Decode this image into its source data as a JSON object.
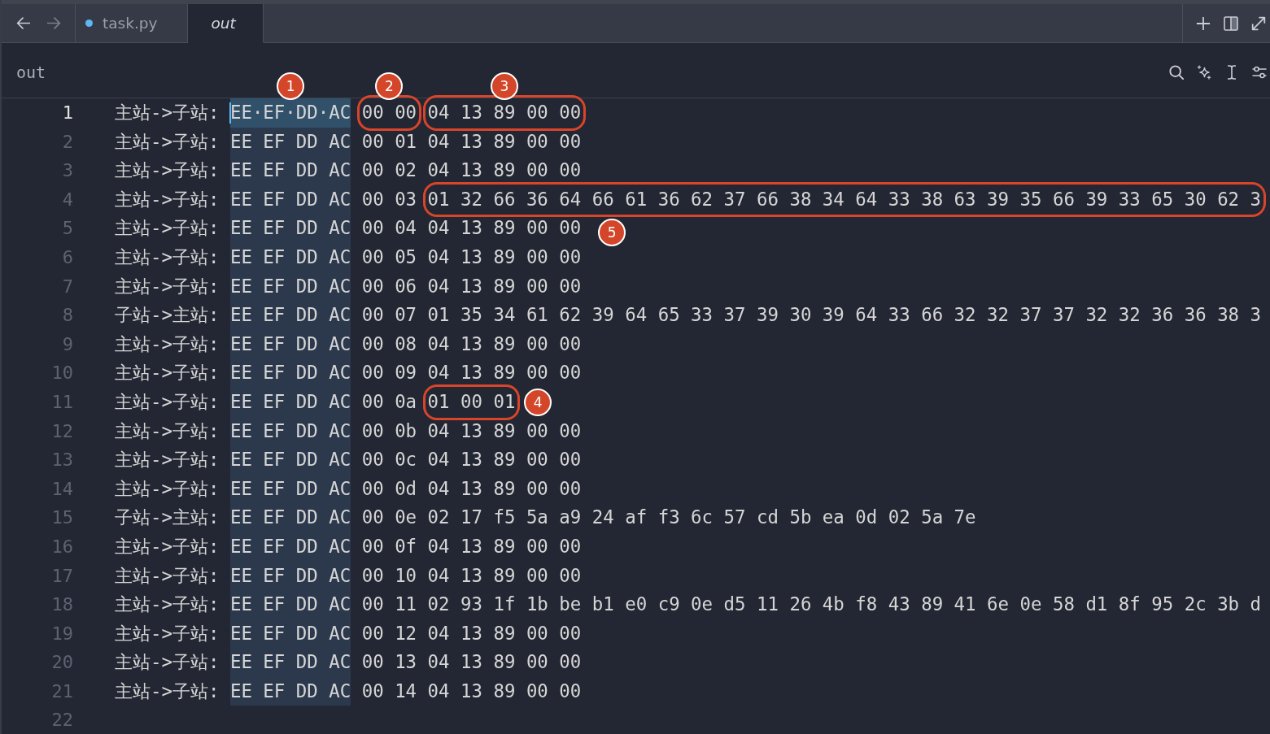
{
  "navigation": [
    {
      "kind": "back",
      "disabled": false
    },
    {
      "kind": "forward",
      "disabled": true
    }
  ],
  "tabs": [
    {
      "label": "task.py",
      "selected": false,
      "modified": true,
      "preview": false
    },
    {
      "label": "out",
      "selected": true,
      "modified": false,
      "preview": true
    }
  ],
  "tab_bar_actions": [
    {
      "kind": "new"
    },
    {
      "kind": "split"
    },
    {
      "kind": "expand"
    }
  ],
  "panel": {
    "title": "out",
    "tools": [
      {
        "kind": "search"
      },
      {
        "kind": "assistant"
      },
      {
        "kind": "cursor"
      },
      {
        "kind": "settings"
      }
    ]
  },
  "editor": {
    "lines": [
      {
        "number": "1",
        "direction": "主站->子站:",
        "header": "EE·EF·DD·AC",
        "sequence": "00 00",
        "payload": "04 13 89 00 00",
        "selected": true,
        "current": true,
        "header_mark": {
          "kind": "above",
          "label": "1",
          "ring": false
        },
        "sequence_mark": {
          "kind": "above",
          "label": "2",
          "ring": true
        },
        "payload_mark": {
          "kind": "above",
          "label": "3",
          "ring": true
        }
      },
      {
        "number": "2",
        "direction": "主站->子站:",
        "header": "EE EF DD AC",
        "sequence": "00 01",
        "payload": "04 13 89 00 00",
        "selected": true,
        "current": false
      },
      {
        "number": "3",
        "direction": "主站->子站:",
        "header": "EE EF DD AC",
        "sequence": "00 02",
        "payload": "04 13 89 00 00",
        "selected": true,
        "current": false
      },
      {
        "number": "4",
        "direction": "主站->子站:",
        "header": "EE EF DD AC",
        "sequence": "00 03",
        "payload": "01 32 66 36 64 66 61 36 62 37 66 38 34 64 33 38 63 39 35 66 39 33 65 30 62 3",
        "selected": true,
        "current": false,
        "payload_mark": {
          "kind": "below",
          "label": "5",
          "ring": true
        }
      },
      {
        "number": "5",
        "direction": "主站->子站:",
        "header": "EE EF DD AC",
        "sequence": "00 04",
        "payload": "04 13 89 00 00",
        "selected": true,
        "current": false
      },
      {
        "number": "6",
        "direction": "主站->子站:",
        "header": "EE EF DD AC",
        "sequence": "00 05",
        "payload": "04 13 89 00 00",
        "selected": true,
        "current": false
      },
      {
        "number": "7",
        "direction": "主站->子站:",
        "header": "EE EF DD AC",
        "sequence": "00 06",
        "payload": "04 13 89 00 00",
        "selected": true,
        "current": false
      },
      {
        "number": "8",
        "direction": "子站->主站:",
        "header": "EE EF DD AC",
        "sequence": "00 07",
        "payload": "01 35 34 61 62 39 64 65 33 37 39 30 39 64 33 66 32 32 37 37 32 32 36 36 38 3",
        "selected": true,
        "current": false
      },
      {
        "number": "9",
        "direction": "主站->子站:",
        "header": "EE EF DD AC",
        "sequence": "00 08",
        "payload": "04 13 89 00 00",
        "selected": true,
        "current": false
      },
      {
        "number": "10",
        "direction": "主站->子站:",
        "header": "EE EF DD AC",
        "sequence": "00 09",
        "payload": "04 13 89 00 00",
        "selected": true,
        "current": false
      },
      {
        "number": "11",
        "direction": "主站->子站:",
        "header": "EE EF DD AC",
        "sequence": "00 0a",
        "payload": "01 00 01",
        "selected": true,
        "current": false,
        "payload_mark": {
          "kind": "right",
          "label": "4",
          "ring": true
        }
      },
      {
        "number": "12",
        "direction": "主站->子站:",
        "header": "EE EF DD AC",
        "sequence": "00 0b",
        "payload": "04 13 89 00 00",
        "selected": true,
        "current": false
      },
      {
        "number": "13",
        "direction": "主站->子站:",
        "header": "EE EF DD AC",
        "sequence": "00 0c",
        "payload": "04 13 89 00 00",
        "selected": true,
        "current": false
      },
      {
        "number": "14",
        "direction": "主站->子站:",
        "header": "EE EF DD AC",
        "sequence": "00 0d",
        "payload": "04 13 89 00 00",
        "selected": true,
        "current": false
      },
      {
        "number": "15",
        "direction": "子站->主站:",
        "header": "EE EF DD AC",
        "sequence": "00 0e",
        "payload": "02 17 f5 5a a9 24 af f3 6c 57 cd 5b ea 0d 02 5a 7e",
        "selected": true,
        "current": false
      },
      {
        "number": "16",
        "direction": "主站->子站:",
        "header": "EE EF DD AC",
        "sequence": "00 0f",
        "payload": "04 13 89 00 00",
        "selected": true,
        "current": false
      },
      {
        "number": "17",
        "direction": "主站->子站:",
        "header": "EE EF DD AC",
        "sequence": "00 10",
        "payload": "04 13 89 00 00",
        "selected": true,
        "current": false
      },
      {
        "number": "18",
        "direction": "主站->子站:",
        "header": "EE EF DD AC",
        "sequence": "00 11",
        "payload": "02 93 1f 1b be b1 e0 c9 0e d5 11 26 4b f8 43 89 41 6e 0e 58 d1 8f 95 2c 3b d",
        "selected": true,
        "current": false
      },
      {
        "number": "19",
        "direction": "主站->子站:",
        "header": "EE EF DD AC",
        "sequence": "00 12",
        "payload": "04 13 89 00 00",
        "selected": true,
        "current": false
      },
      {
        "number": "20",
        "direction": "主站->子站:",
        "header": "EE EF DD AC",
        "sequence": "00 13",
        "payload": "04 13 89 00 00",
        "selected": true,
        "current": false
      },
      {
        "number": "21",
        "direction": "主站->子站:",
        "header": "EE EF DD AC",
        "sequence": "00 14",
        "payload": "04 13 89 00 00",
        "selected": true,
        "current": false
      },
      {
        "number": "22",
        "current": false
      }
    ]
  }
}
